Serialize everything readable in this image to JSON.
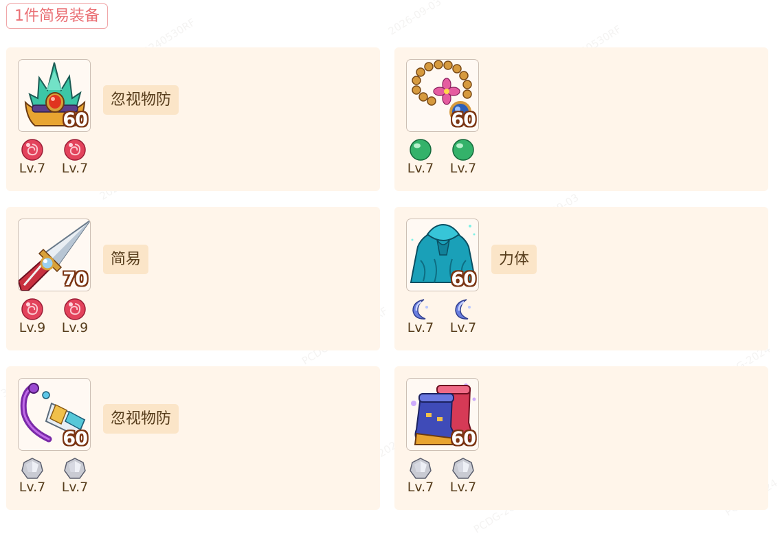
{
  "header": {
    "badge": "1件简易装备"
  },
  "colors": {
    "card_bg": "#fff5ea",
    "badge_accent": "#ea6f74",
    "affix_bg": "#fbe5c8",
    "text_brown": "#573d1c"
  },
  "equipment": [
    {
      "slot": "helmet-icon",
      "level": "60",
      "affix": "忽视物防",
      "gems": [
        {
          "type": "red-gem-icon",
          "label": "Lv.7"
        },
        {
          "type": "red-gem-icon",
          "label": "Lv.7"
        }
      ]
    },
    {
      "slot": "necklace-icon",
      "level": "60",
      "affix": "",
      "gems": [
        {
          "type": "green-gem-icon",
          "label": "Lv.7"
        },
        {
          "type": "green-gem-icon",
          "label": "Lv.7"
        }
      ]
    },
    {
      "slot": "sword-icon",
      "level": "70",
      "affix": "简易",
      "gems": [
        {
          "type": "red-gem-icon",
          "label": "Lv.9"
        },
        {
          "type": "red-gem-icon",
          "label": "Lv.9"
        }
      ]
    },
    {
      "slot": "armor-icon",
      "level": "60",
      "affix": "力体",
      "gems": [
        {
          "type": "moon-gem-icon",
          "label": "Lv.7"
        },
        {
          "type": "moon-gem-icon",
          "label": "Lv.7"
        }
      ]
    },
    {
      "slot": "belt-icon",
      "level": "60",
      "affix": "忽视物防",
      "gems": [
        {
          "type": "white-gem-icon",
          "label": "Lv.7"
        },
        {
          "type": "white-gem-icon",
          "label": "Lv.7"
        }
      ]
    },
    {
      "slot": "boots-icon",
      "level": "60",
      "affix": "",
      "gems": [
        {
          "type": "white-gem-icon",
          "label": "Lv.7"
        },
        {
          "type": "white-gem-icon",
          "label": "Lv.7"
        }
      ]
    }
  ]
}
